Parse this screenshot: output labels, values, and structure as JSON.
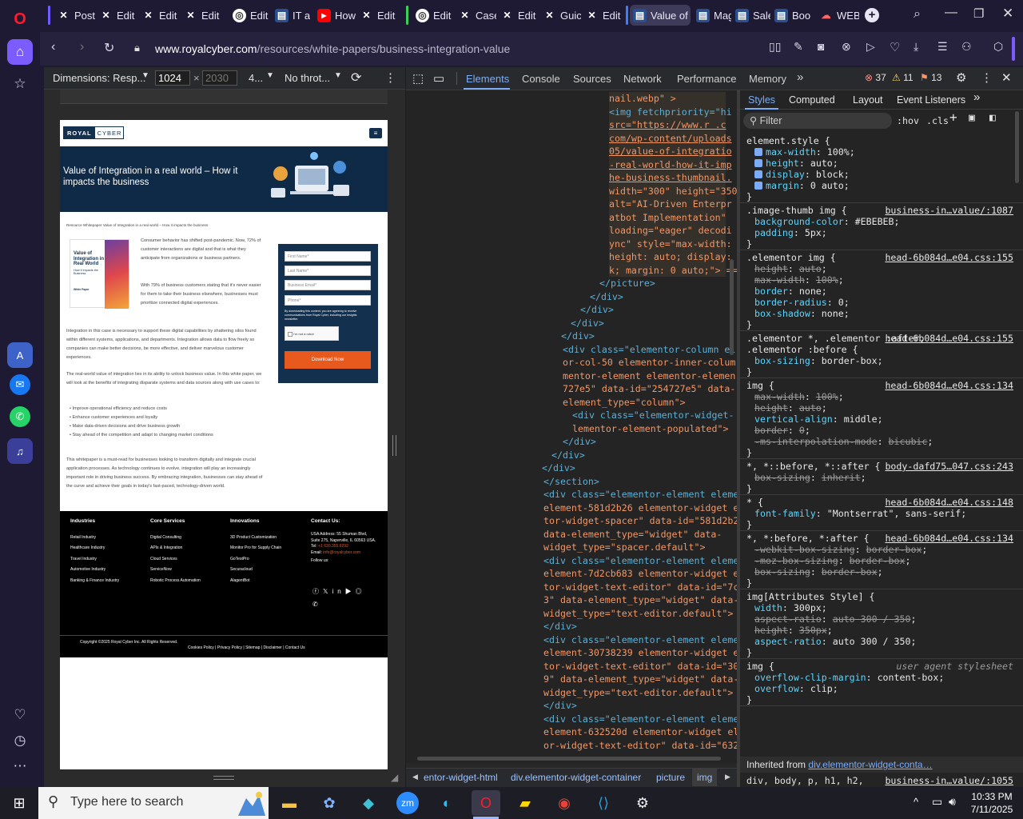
{
  "browser": {
    "tabs": [
      {
        "label": "Post",
        "icon": "x-icon"
      },
      {
        "label": "Edit",
        "icon": "x-icon"
      },
      {
        "label": "Edit",
        "icon": "x-icon"
      },
      {
        "label": "Edit",
        "icon": "x-icon"
      },
      {
        "label": "Edit",
        "icon": "globe-icon"
      },
      {
        "label": "IT ar",
        "icon": "doc-icon"
      },
      {
        "label": "How",
        "icon": "youtube-icon"
      },
      {
        "label": "Edit",
        "icon": "x-icon"
      },
      {
        "label": "Edit",
        "icon": "globe-icon"
      },
      {
        "label": "Case",
        "icon": "x-icon"
      },
      {
        "label": "Edit",
        "icon": "x-icon"
      },
      {
        "label": "Guic",
        "icon": "x-icon"
      },
      {
        "label": "Edit",
        "icon": "x-icon"
      },
      {
        "label": "Value of",
        "icon": "doc-icon"
      },
      {
        "label": "Mag",
        "icon": "doc-icon"
      },
      {
        "label": "Sale",
        "icon": "doc-icon"
      },
      {
        "label": "Boo",
        "icon": "doc-icon"
      },
      {
        "label": "WEB",
        "icon": "cloud-icon"
      }
    ],
    "url_domain": "www.royalcyber.com",
    "url_path": "/resources/white-papers/business-integration-value"
  },
  "device_toolbar": {
    "dimensions_label": "Dimensions: Resp...",
    "width": "1024",
    "height_placeholder": "2030",
    "zoom": "4...",
    "throttle": "No throt..."
  },
  "webpage": {
    "logo_a": "ROYAL",
    "logo_b": "CYBER",
    "hero_title": "Value of Integration in a real world – How it impacts the business",
    "breadcrumb": "Resource Whitepaper Value of Integration in a real world – How it impacts the business",
    "thumb_title": "Value of Integration in a Real World",
    "thumb_sub": "How it impacts the Business",
    "thumb_tag": "White Paper",
    "para1": "Consumer behavior has shifted post-pandemic. Now, 72% of customer interactions are digital and that is what they anticipate from organizations or business partners.",
    "para2": "With 79% of business customers stating that it's never easier for them to take their business elsewhere, businesses must prioritize connected digital experiences.",
    "para3": "Integration in this case is necessary to support these digital capabilities by shattering silos found within different systems, applications, and departments. Integration allows data to flow freely so companies can make better decisions, be more effective, and deliver marvelous customer experiences.",
    "para4": "The real-world value of integration lies in its ability to unlock business value. In this white paper, we will look at the benefits of integrating disparate systems and data sources along with use cases to:",
    "bullets": [
      "Improve operational efficiency and reduce costs",
      "Enhance customer experiences and loyalty",
      "Make data-driven decisions and drive business growth",
      "Stay ahead of the competition and adapt to changing market conditions"
    ],
    "para5": "This whitepaper is a must-read for businesses looking to transform digitally and integrate crucial application processes. As technology continues to evolve, integration will play an increasingly important role in driving business success. By embracing integration, businesses can stay ahead of the curve and achieve their goals in today's fast-paced, technology-driven world.",
    "form": {
      "first_name": "First Name*",
      "last_name": "Last Name*",
      "email": "Business Email*",
      "phone": "Phone*",
      "consent": "By downloading this content, you are agreeing to receive communications from Royal Cyber, including our Insights newsletter.",
      "captcha": "I'm not a robot",
      "button": "Download Now"
    },
    "footer": {
      "industries_h": "Industries",
      "industries": [
        "Retail Industry",
        "Healthcare Industry",
        "Travel Industry",
        "Automotive Industry",
        "Banking & Finance Industry"
      ],
      "core_h": "Core Services",
      "core": [
        "Digital Consulting",
        "APIs & Integration",
        "Cloud Services",
        "ServiceNow",
        "Robotic Process Automation"
      ],
      "innov_h": "Innovations",
      "innov": [
        "3D Product Customization",
        "Monitor Pro for Supply Chain",
        "GoTestPro",
        "Securacloud",
        "AlagentBot"
      ],
      "contact_h": "Contact Us:",
      "address": "USA Address: 55 Shuman Blvd, Suite 275, Naperville, IL 60563 USA.",
      "tel_label": "Tel:",
      "tel": "+1 630.355.6292",
      "email_label": "Email:",
      "email": "info@royalcyber.com",
      "follow": "Follow us:",
      "copyright": "Copyright ©2025 Royal Cyber Inc. All Rights Reserved.",
      "links": "Cookies Policy | Privacy Policy | Sitemap | Disclaimer | Contact Us"
    }
  },
  "devtools": {
    "tabs": [
      "Elements",
      "Console",
      "Sources",
      "Network",
      "Performance",
      "Memory"
    ],
    "errors": "37",
    "warnings": "11",
    "issues": "13",
    "styles_tabs": [
      "Styles",
      "Computed",
      "Layout",
      "Event Listeners"
    ],
    "filter_placeholder": "Filter",
    "hov": ":hov",
    "cls": ".cls",
    "breadcrumbs": [
      "entor-widget-html",
      "div.elementor-widget-container",
      "picture",
      "img"
    ],
    "code_lines": [
      {
        "t": "nail.webp\" >",
        "c": "av"
      },
      {
        "t": "<img fetchpriority=\"hi",
        "c": "tg"
      },
      {
        "t": "src=\"https://www.r   .c",
        "c": "lk"
      },
      {
        "t": "com/wp-content/uploads",
        "c": "lk"
      },
      {
        "t": "05/value-of-integratio",
        "c": "lk"
      },
      {
        "t": "-real-world-how-it-imp",
        "c": "lk"
      },
      {
        "t": "he-business-thumbnail.",
        "c": "lk"
      },
      {
        "t": "width=\"300\" height=\"350",
        "c": "av"
      },
      {
        "t": "alt=\"AI-Driven Enterpr",
        "c": "av"
      },
      {
        "t": "atbot Implementation\"",
        "c": "av"
      },
      {
        "t": "loading=\"eager\" decodi",
        "c": "av"
      },
      {
        "t": "ync\" style=\"max-width:",
        "c": "av"
      },
      {
        "t": "height: auto; display:",
        "c": "av"
      },
      {
        "t": "k; margin: 0 auto;\"> ==",
        "c": "av"
      },
      {
        "t": "</picture>",
        "c": "tg"
      },
      {
        "t": "</div>",
        "c": "tg"
      },
      {
        "t": "</div>",
        "c": "tg"
      },
      {
        "t": "</div>",
        "c": "tg"
      },
      {
        "t": "</div>",
        "c": "tg"
      },
      {
        "t": "<div class=\"elementor-column el",
        "c": "tg"
      },
      {
        "t": "or-col-50 elementor-inner-colum",
        "c": "av"
      },
      {
        "t": "mentor-element elementor-elemen",
        "c": "av"
      },
      {
        "t": "727e5\" data-id=\"254727e5\" data-",
        "c": "av"
      },
      {
        "t": "element_type=\"column\">",
        "c": "av"
      },
      {
        "t": "<div class=\"elementor-widget-",
        "c": "tg"
      },
      {
        "t": "lementor-element-populated\">",
        "c": "av"
      },
      {
        "t": "</div>",
        "c": "tg"
      },
      {
        "t": "</div>",
        "c": "tg"
      },
      {
        "t": "</div>",
        "c": "tg"
      },
      {
        "t": "</section>",
        "c": "tg"
      },
      {
        "t": "<div class=\"elementor-element eleme",
        "c": "tg"
      },
      {
        "t": "element-581d2b26 elementor-widget e",
        "c": "av"
      },
      {
        "t": "tor-widget-spacer\" data-id=\"581d2b2",
        "c": "av"
      },
      {
        "t": "data-element_type=\"widget\" data-",
        "c": "av"
      },
      {
        "t": "widget_type=\"spacer.default\">",
        "c": "av"
      },
      {
        "t": "<div class=\"elementor-element eleme",
        "c": "tg"
      },
      {
        "t": "element-7d2cb683 elementor-widget e",
        "c": "av"
      },
      {
        "t": "tor-widget-text-editor\" data-id=\"7c",
        "c": "av"
      },
      {
        "t": "3\" data-element_type=\"widget\" data-",
        "c": "av"
      },
      {
        "t": "widget_type=\"text-editor.default\">",
        "c": "av"
      },
      {
        "t": "</div>",
        "c": "tg"
      },
      {
        "t": "<div class=\"elementor-element eleme",
        "c": "tg"
      },
      {
        "t": "element-30738239 elementor-widget e",
        "c": "av"
      },
      {
        "t": "tor-widget-text-editor\" data-id=\"30",
        "c": "av"
      },
      {
        "t": "9\" data-element_type=\"widget\" data-",
        "c": "av"
      },
      {
        "t": "widget_type=\"text-editor.default\">",
        "c": "av"
      },
      {
        "t": "</div>",
        "c": "tg"
      },
      {
        "t": "<div class=\"elementor-element eleme",
        "c": "tg"
      },
      {
        "t": "element-632520d elementor-widget el",
        "c": "av"
      },
      {
        "t": "or-widget-text-editor\" data-id=\"632",
        "c": "av"
      },
      {
        "t": "data-element_type=\"widget\" data-",
        "c": "av"
      }
    ],
    "rules": [
      {
        "sel": "element.style {",
        "src": "",
        "props": [
          [
            "max-width",
            "100%",
            false,
            true
          ],
          [
            "height",
            "auto",
            false,
            true
          ],
          [
            "display",
            "block",
            false,
            true
          ],
          [
            "margin",
            "0 auto",
            false,
            true
          ]
        ]
      },
      {
        "sel": ".image-thumb img {",
        "src": "business-in…value/:1087",
        "props": [
          [
            "background-color",
            "#EBEBEB",
            false,
            false
          ],
          [
            "padding",
            "5px",
            false,
            false
          ]
        ]
      },
      {
        "sel": ".elementor img {",
        "src": "head-6b084d…e04.css:155",
        "props": [
          [
            "height",
            "auto",
            true,
            false
          ],
          [
            "max-width",
            "100%",
            true,
            false
          ],
          [
            "border",
            "none",
            false,
            false
          ],
          [
            "border-radius",
            "0",
            false,
            false
          ],
          [
            "box-shadow",
            "none",
            false,
            false
          ]
        ]
      },
      {
        "sel": ".elementor *, .elementor :after, .elementor :before {",
        "src": "head-6b084d…e04.css:155",
        "props": [
          [
            "box-sizing",
            "border-box",
            false,
            false
          ]
        ]
      },
      {
        "sel": "img {",
        "src": "head-6b084d…e04.css:134",
        "props": [
          [
            "max-width",
            "100%",
            true,
            false
          ],
          [
            "height",
            "auto",
            true,
            false
          ],
          [
            "vertical-align",
            "middle",
            false,
            false
          ],
          [
            "border",
            "0",
            true,
            false
          ],
          [
            "-ms-interpolation-mode",
            "bicubic",
            true,
            false
          ]
        ]
      },
      {
        "sel": "*, *::before, *::after {",
        "src": "body-dafd75…047.css:243",
        "props": [
          [
            "box-sizing",
            "inherit",
            true,
            false
          ]
        ]
      },
      {
        "sel": "* {",
        "src": "head-6b084d…e04.css:148",
        "props": [
          [
            "font-family",
            "\"Montserrat\", sans-serif",
            false,
            false
          ]
        ]
      },
      {
        "sel": "*, *:before, *:after {",
        "src": "head-6b084d…e04.css:134",
        "props": [
          [
            "-webkit-box-sizing",
            "border-box",
            true,
            false
          ],
          [
            "-moz-box-sizing",
            "border-box",
            true,
            false
          ],
          [
            "box-sizing",
            "border-box",
            true,
            false
          ]
        ]
      },
      {
        "sel": "img[Attributes Style] {",
        "src": "",
        "props": [
          [
            "width",
            "300px",
            false,
            false
          ],
          [
            "aspect-ratio",
            "auto 300 / 350",
            true,
            false
          ],
          [
            "height",
            "350px",
            true,
            false
          ],
          [
            "aspect-ratio",
            "auto 300 / 350",
            false,
            false
          ]
        ]
      },
      {
        "sel": "img {",
        "src": "user agent stylesheet",
        "props": [
          [
            "overflow-clip-margin",
            "content-box",
            false,
            false
          ],
          [
            "overflow",
            "clip",
            false,
            false
          ]
        ]
      }
    ],
    "inherited_label": "Inherited from",
    "inherited_from": "div.elementor-widget-conta…",
    "last_rule": "div, body, p, h1, h2,",
    "last_src": "business-in…value/:1055"
  },
  "taskbar": {
    "search_placeholder": "Type here to search",
    "time": "10:33 PM",
    "date": "7/11/2025"
  },
  "colors": {
    "royal_navy": "#14304f",
    "download_orange": "#e8591d",
    "devtools_link": "#7cacf8"
  }
}
